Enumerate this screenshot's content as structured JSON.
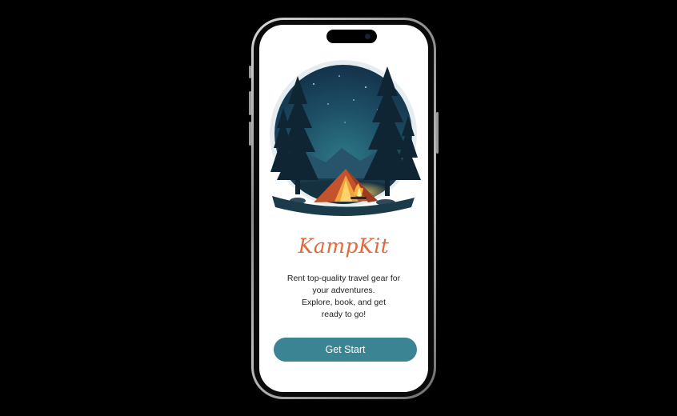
{
  "app": {
    "brand_name": "KampKit",
    "tagline_lines": [
      "Rent top-quality travel gear for",
      "your adventures.",
      "Explore, book, and get",
      "ready to go!"
    ],
    "cta_label": "Get Start"
  },
  "illustration": {
    "subject": "tent-campfire-forest-night-icon"
  },
  "colors": {
    "page_background": "#000000",
    "screen_background": "#ffffff",
    "brand": "#e0683a",
    "cta_background": "#3b8494",
    "cta_text": "#ffffff",
    "body_text": "#1e1e1e"
  }
}
